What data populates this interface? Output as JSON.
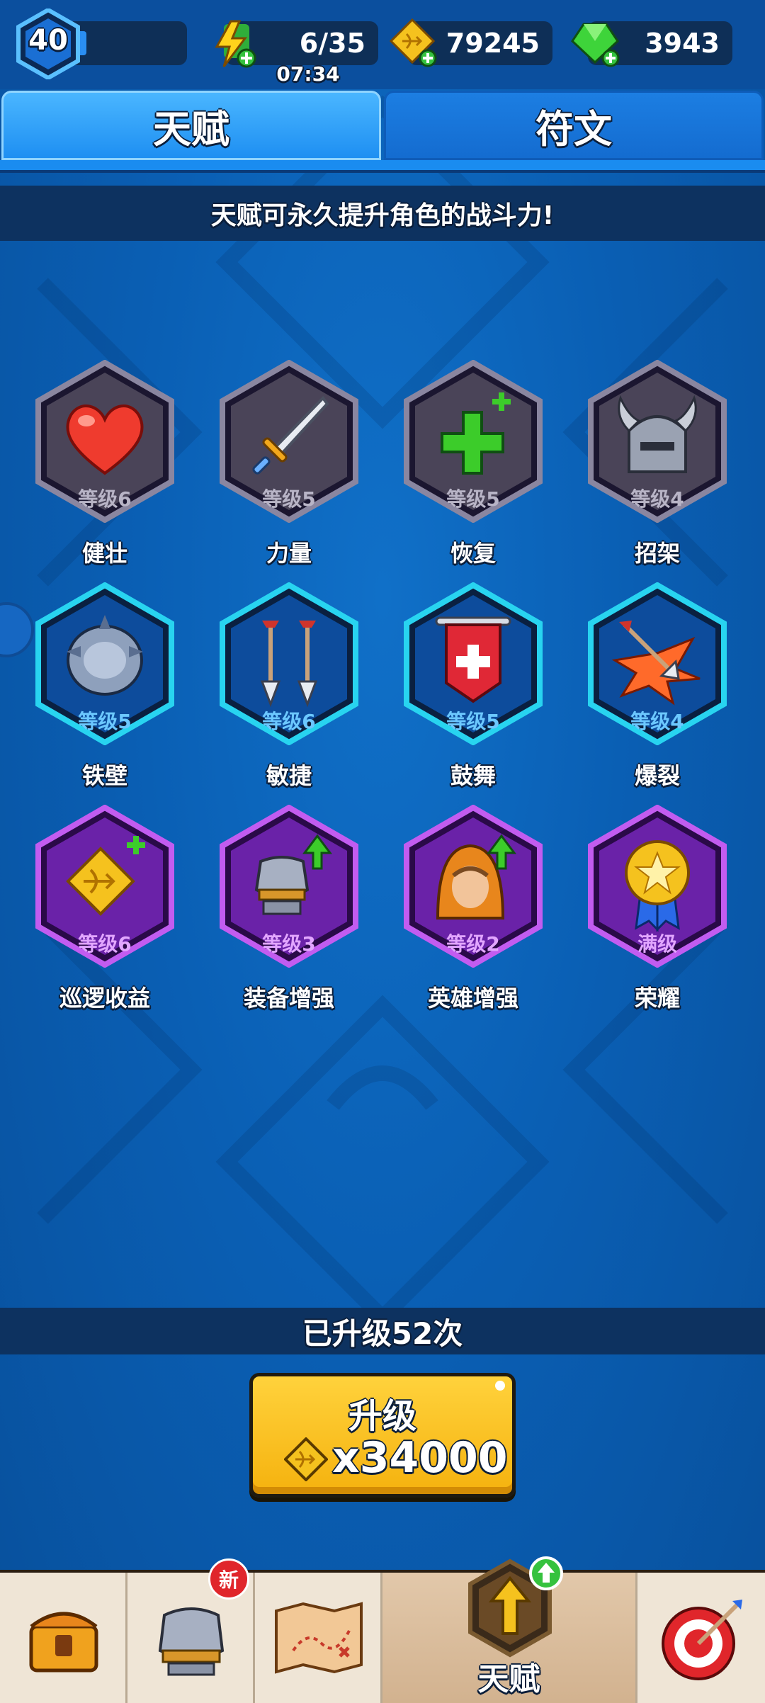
{
  "topbar": {
    "player_level": "40",
    "energy": "6/35",
    "energy_timer": "07:34",
    "coins": "79245",
    "gems": "3943"
  },
  "tabs": [
    {
      "label": "天赋",
      "active": true
    },
    {
      "label": "符文",
      "active": false
    }
  ],
  "banner_text": "天赋可永久提升角色的战斗力!",
  "talents": [
    {
      "name": "健壮",
      "level": "等级6",
      "tier": "gray",
      "icon": "heart-icon"
    },
    {
      "name": "力量",
      "level": "等级5",
      "tier": "gray",
      "icon": "sword-icon"
    },
    {
      "name": "恢复",
      "level": "等级5",
      "tier": "gray",
      "icon": "green-cross-icon"
    },
    {
      "name": "招架",
      "level": "等级4",
      "tier": "gray",
      "icon": "horned-helmet-icon"
    },
    {
      "name": "铁壁",
      "level": "等级5",
      "tier": "blue",
      "icon": "spiked-shield-icon"
    },
    {
      "name": "敏捷",
      "level": "等级6",
      "tier": "blue",
      "icon": "double-arrow-icon"
    },
    {
      "name": "鼓舞",
      "level": "等级5",
      "tier": "blue",
      "icon": "red-banner-icon"
    },
    {
      "name": "爆裂",
      "level": "等级4",
      "tier": "blue",
      "icon": "explosive-arrow-icon"
    },
    {
      "name": "巡逻收益",
      "level": "等级6",
      "tier": "purple",
      "icon": "gold-coin-plus-icon"
    },
    {
      "name": "装备增强",
      "level": "等级3",
      "tier": "purple",
      "icon": "armor-up-icon"
    },
    {
      "name": "英雄增强",
      "level": "等级2",
      "tier": "purple",
      "icon": "hooded-hero-up-icon"
    },
    {
      "name": "荣耀",
      "level": "满级",
      "tier": "purple",
      "icon": "gold-medal-icon"
    }
  ],
  "upgrade_count_text": "已升级52次",
  "upgrade_button": {
    "label": "升级",
    "cost": "x34000"
  },
  "nav": {
    "new_badge": "新",
    "active_label": "天赋"
  },
  "colors": {
    "gray_hex": "#4a4458",
    "blue_hex": "#0d4c9c",
    "purple_hex": "#6a22a8",
    "button_yellow": "#f5b20e"
  }
}
